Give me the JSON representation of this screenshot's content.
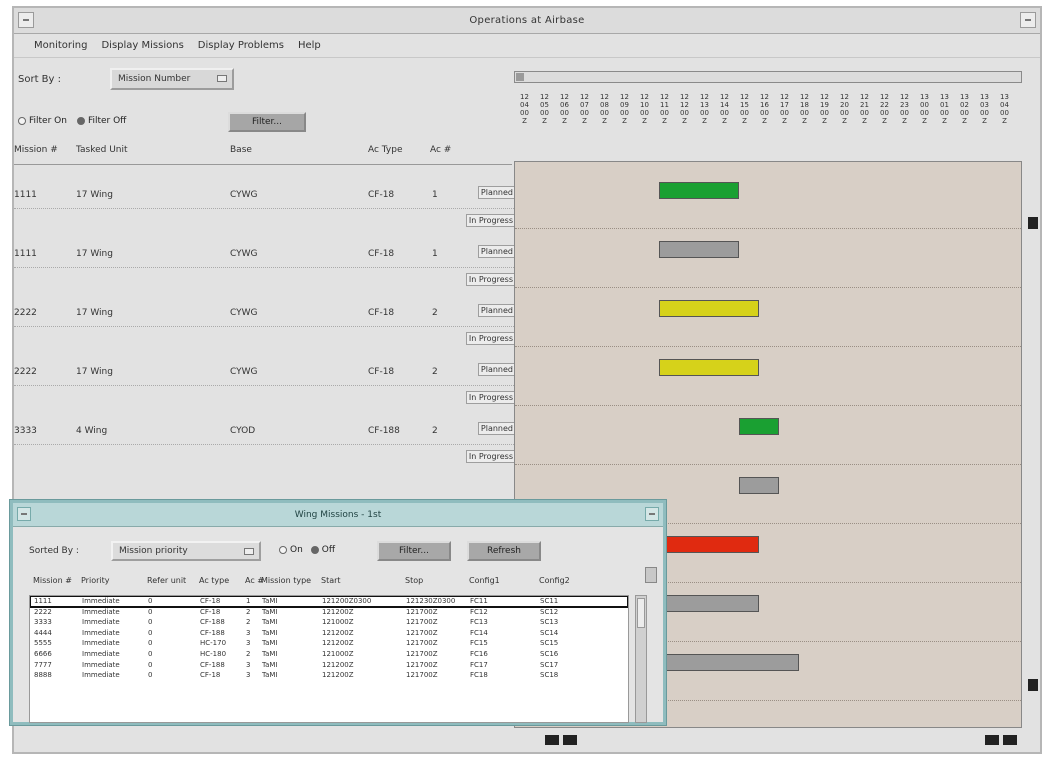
{
  "window": {
    "title": "Operations at Airbase"
  },
  "menu": {
    "items": [
      "Monitoring",
      "Display Missions",
      "Display Problems",
      "Help"
    ]
  },
  "controls": {
    "sort_label": "Sort By :",
    "sort_value": "Mission Number",
    "filter_on": "Filter On",
    "filter_off": "Filter Off",
    "filter_button": "Filter..."
  },
  "columns": {
    "mission": "Mission #",
    "unit": "Tasked Unit",
    "base": "Base",
    "ac_type": "Ac Type",
    "ac_count": "Ac #"
  },
  "missions": [
    {
      "id": "1111",
      "unit": "17 Wing",
      "base": "CYWG",
      "ac_type": "CF-18",
      "ac_count": "1",
      "planned": "Planned",
      "in_progress": "In Progress"
    },
    {
      "id": "1111",
      "unit": "17 Wing",
      "base": "CYWG",
      "ac_type": "CF-18",
      "ac_count": "1",
      "planned": "Planned",
      "in_progress": "In Progress"
    },
    {
      "id": "2222",
      "unit": "17 Wing",
      "base": "CYWG",
      "ac_type": "CF-18",
      "ac_count": "2",
      "planned": "Planned",
      "in_progress": "In Progress"
    },
    {
      "id": "2222",
      "unit": "17 Wing",
      "base": "CYWG",
      "ac_type": "CF-18",
      "ac_count": "2",
      "planned": "Planned",
      "in_progress": "In Progress"
    },
    {
      "id": "3333",
      "unit": "4 Wing",
      "base": "CYOD",
      "ac_type": "CF-188",
      "ac_count": "2",
      "planned": "Planned",
      "in_progress": "In Progress"
    }
  ],
  "time_axis": {
    "ticks": [
      [
        "12",
        "04",
        "00",
        "Z"
      ],
      [
        "12",
        "05",
        "00",
        "Z"
      ],
      [
        "12",
        "06",
        "00",
        "Z"
      ],
      [
        "12",
        "07",
        "00",
        "Z"
      ],
      [
        "12",
        "08",
        "00",
        "Z"
      ],
      [
        "12",
        "09",
        "00",
        "Z"
      ],
      [
        "12",
        "10",
        "00",
        "Z"
      ],
      [
        "12",
        "11",
        "00",
        "Z"
      ],
      [
        "12",
        "12",
        "00",
        "Z"
      ],
      [
        "12",
        "13",
        "00",
        "Z"
      ],
      [
        "12",
        "14",
        "00",
        "Z"
      ],
      [
        "12",
        "15",
        "00",
        "Z"
      ],
      [
        "12",
        "16",
        "00",
        "Z"
      ],
      [
        "12",
        "17",
        "00",
        "Z"
      ],
      [
        "12",
        "18",
        "00",
        "Z"
      ],
      [
        "12",
        "19",
        "00",
        "Z"
      ],
      [
        "12",
        "20",
        "00",
        "Z"
      ],
      [
        "12",
        "21",
        "00",
        "Z"
      ],
      [
        "12",
        "22",
        "00",
        "Z"
      ],
      [
        "12",
        "23",
        "00",
        "Z"
      ],
      [
        "13",
        "00",
        "00",
        "Z"
      ],
      [
        "13",
        "01",
        "00",
        "Z"
      ],
      [
        "13",
        "02",
        "00",
        "Z"
      ],
      [
        "13",
        "03",
        "00",
        "Z"
      ],
      [
        "13",
        "04",
        "00",
        "Z"
      ]
    ]
  },
  "gantt": {
    "colors": {
      "green": "#1aa032",
      "gray": "#9c9c9c",
      "yellow": "#d6d21a",
      "red": "#e02a10"
    },
    "bars": [
      {
        "row": 0,
        "color": "green",
        "start": 7,
        "end": 11
      },
      {
        "row": 1,
        "color": "gray",
        "start": 7,
        "end": 11
      },
      {
        "row": 2,
        "color": "yellow",
        "start": 7,
        "end": 12
      },
      {
        "row": 3,
        "color": "yellow",
        "start": 7,
        "end": 12
      },
      {
        "row": 4,
        "color": "green",
        "start": 11,
        "end": 13
      },
      {
        "row": 5,
        "color": "gray",
        "start": 11,
        "end": 13
      },
      {
        "row": 6,
        "color": "red",
        "start": 7,
        "end": 12
      },
      {
        "row": 7,
        "color": "gray",
        "start": 7,
        "end": 12
      },
      {
        "row": 8,
        "color": "gray",
        "start": 7,
        "end": 14
      }
    ]
  },
  "mission_window": {
    "title": "Wing Missions - 1st",
    "sort_label": "Sorted By :",
    "sort_value": "Mission priority",
    "radio_on": "On",
    "radio_off": "Off",
    "filter_button": "Filter...",
    "refresh_button": "Refresh",
    "headers": [
      "Mission #",
      "Priority",
      "Refer unit",
      "Ac type",
      "Ac #",
      "Mission type",
      "Start",
      "Stop",
      "Config1",
      "Config2"
    ],
    "rows": [
      [
        "1111",
        "Immediate",
        "0",
        "CF-18",
        "1",
        "TaMI",
        "121200Z0300",
        "121230Z0300",
        "FC11",
        "SC11"
      ],
      [
        "2222",
        "Immediate",
        "0",
        "CF-18",
        "2",
        "TaMI",
        "121200Z",
        "121700Z",
        "FC12",
        "SC12"
      ],
      [
        "3333",
        "Immediate",
        "0",
        "CF-188",
        "2",
        "TaMI",
        "121000Z",
        "121700Z",
        "FC13",
        "SC13"
      ],
      [
        "4444",
        "Immediate",
        "0",
        "CF-188",
        "3",
        "TaMI",
        "121200Z",
        "121700Z",
        "FC14",
        "SC14"
      ],
      [
        "5555",
        "Immediate",
        "0",
        "HC-170",
        "3",
        "TaMI",
        "121200Z",
        "121700Z",
        "FC15",
        "SC15"
      ],
      [
        "6666",
        "Immediate",
        "0",
        "HC-180",
        "2",
        "TaMI",
        "121000Z",
        "121700Z",
        "FC16",
        "SC16"
      ],
      [
        "7777",
        "Immediate",
        "0",
        "CF-188",
        "3",
        "TaMI",
        "121200Z",
        "121700Z",
        "FC17",
        "SC17"
      ],
      [
        "8888",
        "Immediate",
        "0",
        "CF-18",
        "3",
        "TaMI",
        "121200Z",
        "121700Z",
        "FC18",
        "SC18"
      ]
    ]
  }
}
